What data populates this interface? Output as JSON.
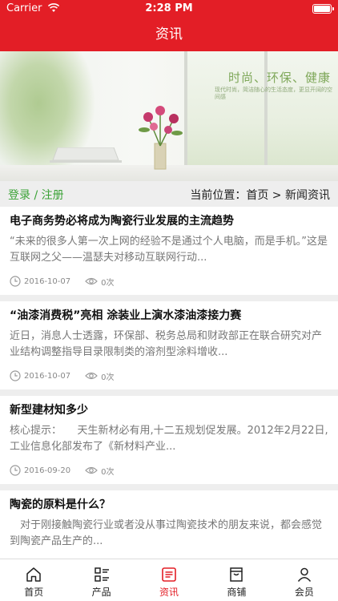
{
  "status": {
    "carrier": "Carrier",
    "time": "2:28 PM"
  },
  "nav": {
    "title": "资讯"
  },
  "banner": {
    "headline": "时尚、环保、健康",
    "subline": "现代时尚，简洁随心的生活态度，更显开阔的空间感"
  },
  "crumbs": {
    "login": "登录 / 注册",
    "location": "当前位置：首页 > 新闻资讯"
  },
  "articles": [
    {
      "title": "电子商务势必将成为陶瓷行业发展的主流趋势",
      "summary": "“未来的很多人第一次上网的经验不是通过个人电脑，而是手机。”这是互联网之父——温瑟夫对移动互联网行动...",
      "date": "2016-10-07",
      "views": "0次"
    },
    {
      "title": "“油漆消费税”亮相 涂装业上演水漆油漆接力赛",
      "summary": "近日，消息人士透露，环保部、税务总局和财政部正在联合研究对产业结构调整指导目录限制类的溶剂型涂料增收...",
      "date": "2016-10-07",
      "views": "0次"
    },
    {
      "title": "新型建材知多少",
      "summary": "核心提示：　　天生新材必有用,十二五规划促发展。2012年2月22日,工业信息化部发布了《新材料产业...",
      "date": "2016-09-20",
      "views": "0次"
    },
    {
      "title": "陶瓷的原料是什么？",
      "summary": "　对于刚接触陶瓷行业或者没从事过陶瓷技术的朋友来说，都会感觉到陶瓷产品生产的...",
      "date": "",
      "views": ""
    }
  ],
  "tabs": [
    {
      "label": "首页",
      "icon": "home-icon"
    },
    {
      "label": "产品",
      "icon": "grid-list-icon"
    },
    {
      "label": "资讯",
      "icon": "news-icon"
    },
    {
      "label": "商铺",
      "icon": "store-icon"
    },
    {
      "label": "会员",
      "icon": "user-icon"
    }
  ],
  "colors": {
    "brand": "#e31e26",
    "login_green": "#3aa236"
  }
}
